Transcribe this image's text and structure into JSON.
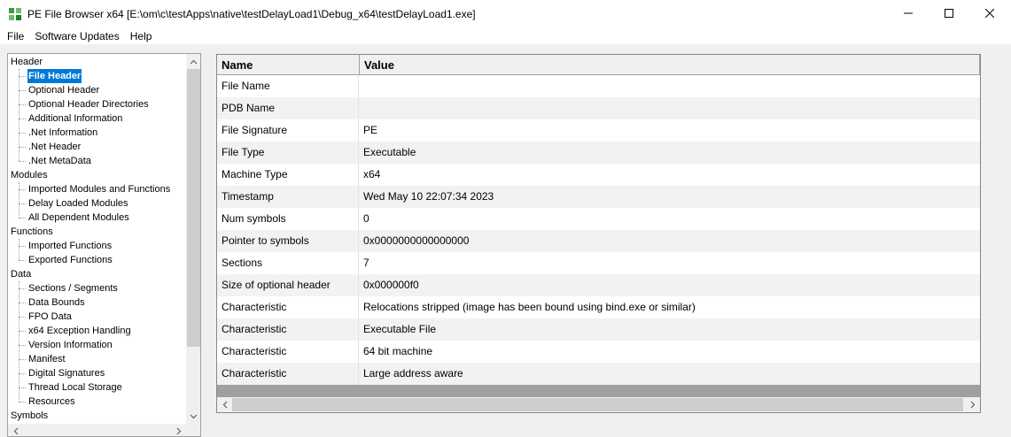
{
  "window": {
    "title": "PE File Browser x64 [E:\\om\\c\\testApps\\native\\testDelayLoad1\\Debug_x64\\testDelayLoad1.exe]",
    "minimize_glyph": "—",
    "maximize_glyph": "☐",
    "close_glyph": "✕",
    "icon": "pe-app-icon"
  },
  "menu": [
    "File",
    "Software Updates",
    "Help"
  ],
  "tree": {
    "groups": [
      {
        "label": "Header",
        "children": [
          "File Header",
          "Optional Header",
          "Optional Header Directories",
          "Additional Information",
          ".Net Information",
          ".Net Header",
          ".Net MetaData"
        ]
      },
      {
        "label": "Modules",
        "children": [
          "Imported Modules and Functions",
          "Delay Loaded Modules",
          "All Dependent Modules"
        ]
      },
      {
        "label": "Functions",
        "children": [
          "Imported Functions",
          "Exported Functions"
        ]
      },
      {
        "label": "Data",
        "children": [
          "Sections / Segments",
          "Data Bounds",
          "FPO Data",
          "x64 Exception Handling",
          "Version Information",
          "Manifest",
          "Digital Signatures",
          "Thread Local Storage",
          "Resources"
        ]
      },
      {
        "label": "Symbols",
        "children": []
      }
    ],
    "selected": "File Header",
    "scroll_up": "^",
    "scroll_down": "v",
    "scroll_left": "<",
    "scroll_right": ">"
  },
  "grid": {
    "columns": [
      "Name",
      "Value"
    ],
    "rows": [
      [
        "File Name",
        ""
      ],
      [
        "PDB Name",
        ""
      ],
      [
        "File Signature",
        "PE"
      ],
      [
        "File Type",
        "Executable"
      ],
      [
        "Machine Type",
        "x64"
      ],
      [
        "Timestamp",
        "Wed May 10 22:07:34 2023"
      ],
      [
        "Num symbols",
        "0"
      ],
      [
        "Pointer to symbols",
        "0x0000000000000000"
      ],
      [
        "Sections",
        "7"
      ],
      [
        "Size of optional header",
        "0x000000f0"
      ],
      [
        "Characteristic",
        "Relocations stripped (image has been bound using bind.exe or similar)"
      ],
      [
        "Characteristic",
        "Executable File"
      ],
      [
        "Characteristic",
        "64 bit machine"
      ],
      [
        "Characteristic",
        "Large address aware"
      ]
    ],
    "scroll_left": "<",
    "scroll_right": ">"
  },
  "colors": {
    "selection": "#0078d7",
    "grid_background": "#a0a0a0"
  }
}
